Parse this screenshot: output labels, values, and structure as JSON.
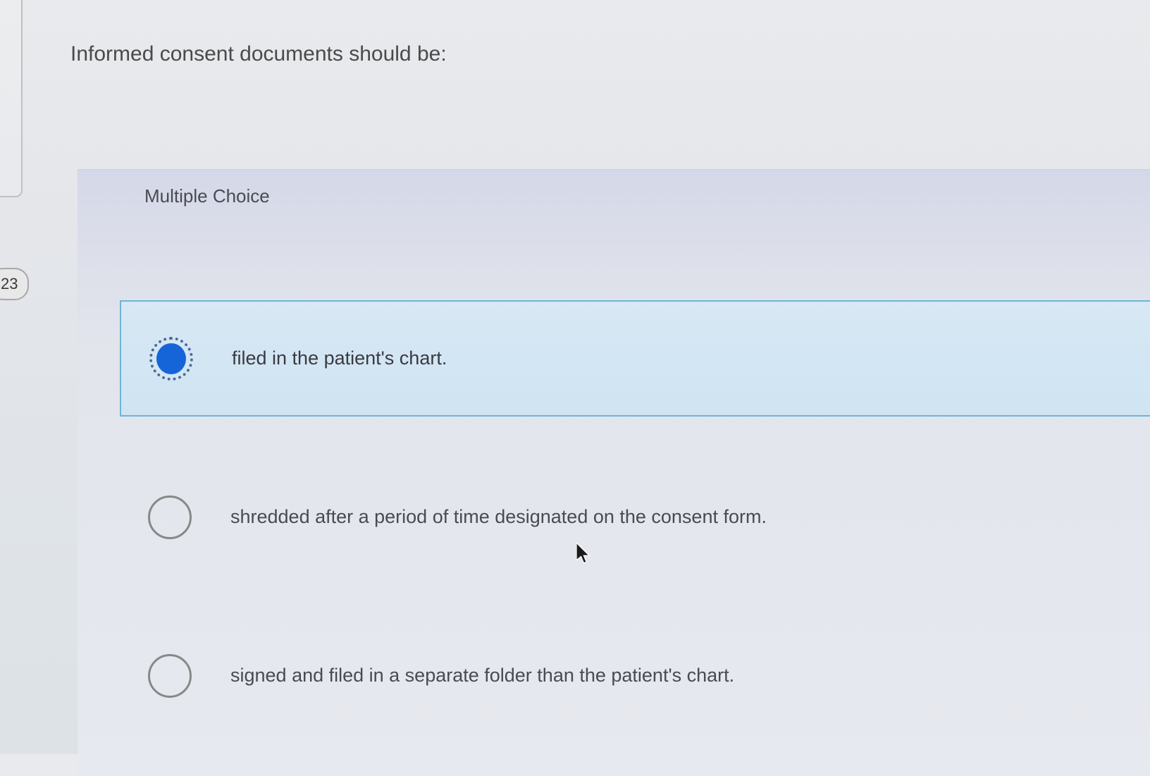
{
  "question": {
    "text": "Informed consent documents should be:",
    "type_label": "Multiple Choice",
    "badge_number": "23"
  },
  "options": [
    {
      "label": "filed in the patient's chart.",
      "selected": true
    },
    {
      "label": "shredded after a period of time designated on the consent form.",
      "selected": false
    },
    {
      "label": "signed and filed in a separate folder than the patient's chart.",
      "selected": false
    }
  ]
}
